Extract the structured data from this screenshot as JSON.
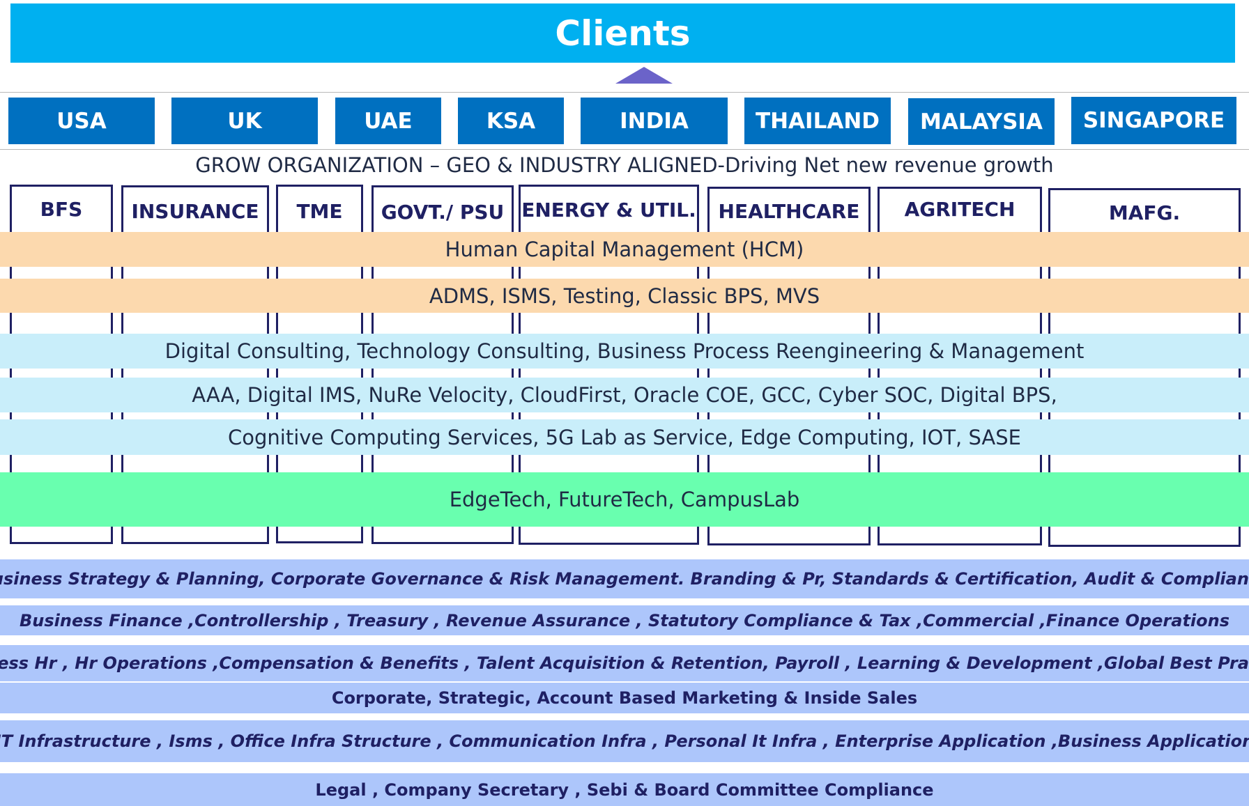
{
  "clients": {
    "title": "Clients"
  },
  "geographies": [
    "USA",
    "UK",
    "UAE",
    "KSA",
    "INDIA",
    "THAILAND",
    "MALAYSIA",
    "SINGAPORE"
  ],
  "grow_title": "GROW ORGANIZATION – GEO & INDUSTRY ALIGNED-Driving Net new revenue growth",
  "industries": [
    "BFS",
    "INSURANCE",
    "TME",
    "GOVT./ PSU",
    "ENERGY & UTIL.",
    "HEALTHCARE",
    "AGRITECH",
    "MAFG."
  ],
  "capability_bands": [
    "Human Capital Management (HCM)",
    "ADMS, ISMS, Testing, Classic BPS, MVS",
    "Digital Consulting, Technology Consulting, Business Process Reengineering & Management",
    "AAA, Digital IMS, NuRe Velocity, CloudFirst, Oracle COE, GCC, Cyber SOC, Digital BPS,",
    "Cognitive Computing Services, 5G Lab as Service, Edge Computing, IOT, SASE",
    "EdgeTech, FutureTech, CampusLab"
  ],
  "functions": [
    "Business Strategy & Planning, Corporate Governance & Risk Management. Branding & Pr, Standards & Certification, Audit & Compliance",
    "Business Finance ,Controllership , Treasury , Revenue Assurance , Statutory Compliance & Tax ,Commercial ,Finance Operations",
    "Business Hr , Hr Operations ,Compensation & Benefits , Talent Acquisition  & Retention, Payroll , Learning & Development ,Global Best Practises",
    "Corporate, Strategic, Account Based Marketing & Inside Sales",
    "IT Infrastructure , Isms , Office Infra Structure , Communication Infra , Personal It Infra , Enterprise Application ,Business Application",
    "Legal , Company Secretary , Sebi & Board Committee  Compliance"
  ],
  "colors": {
    "clients_banner": "#00b0f0",
    "geo_box": "#0070c0",
    "arrow": "#6b63c9",
    "industry_border": "#1f2063",
    "band_orange": "#fcd9ae",
    "band_lightblue": "#c9eefa",
    "band_green": "#69ffaf",
    "function_band": "#adc6fb"
  }
}
